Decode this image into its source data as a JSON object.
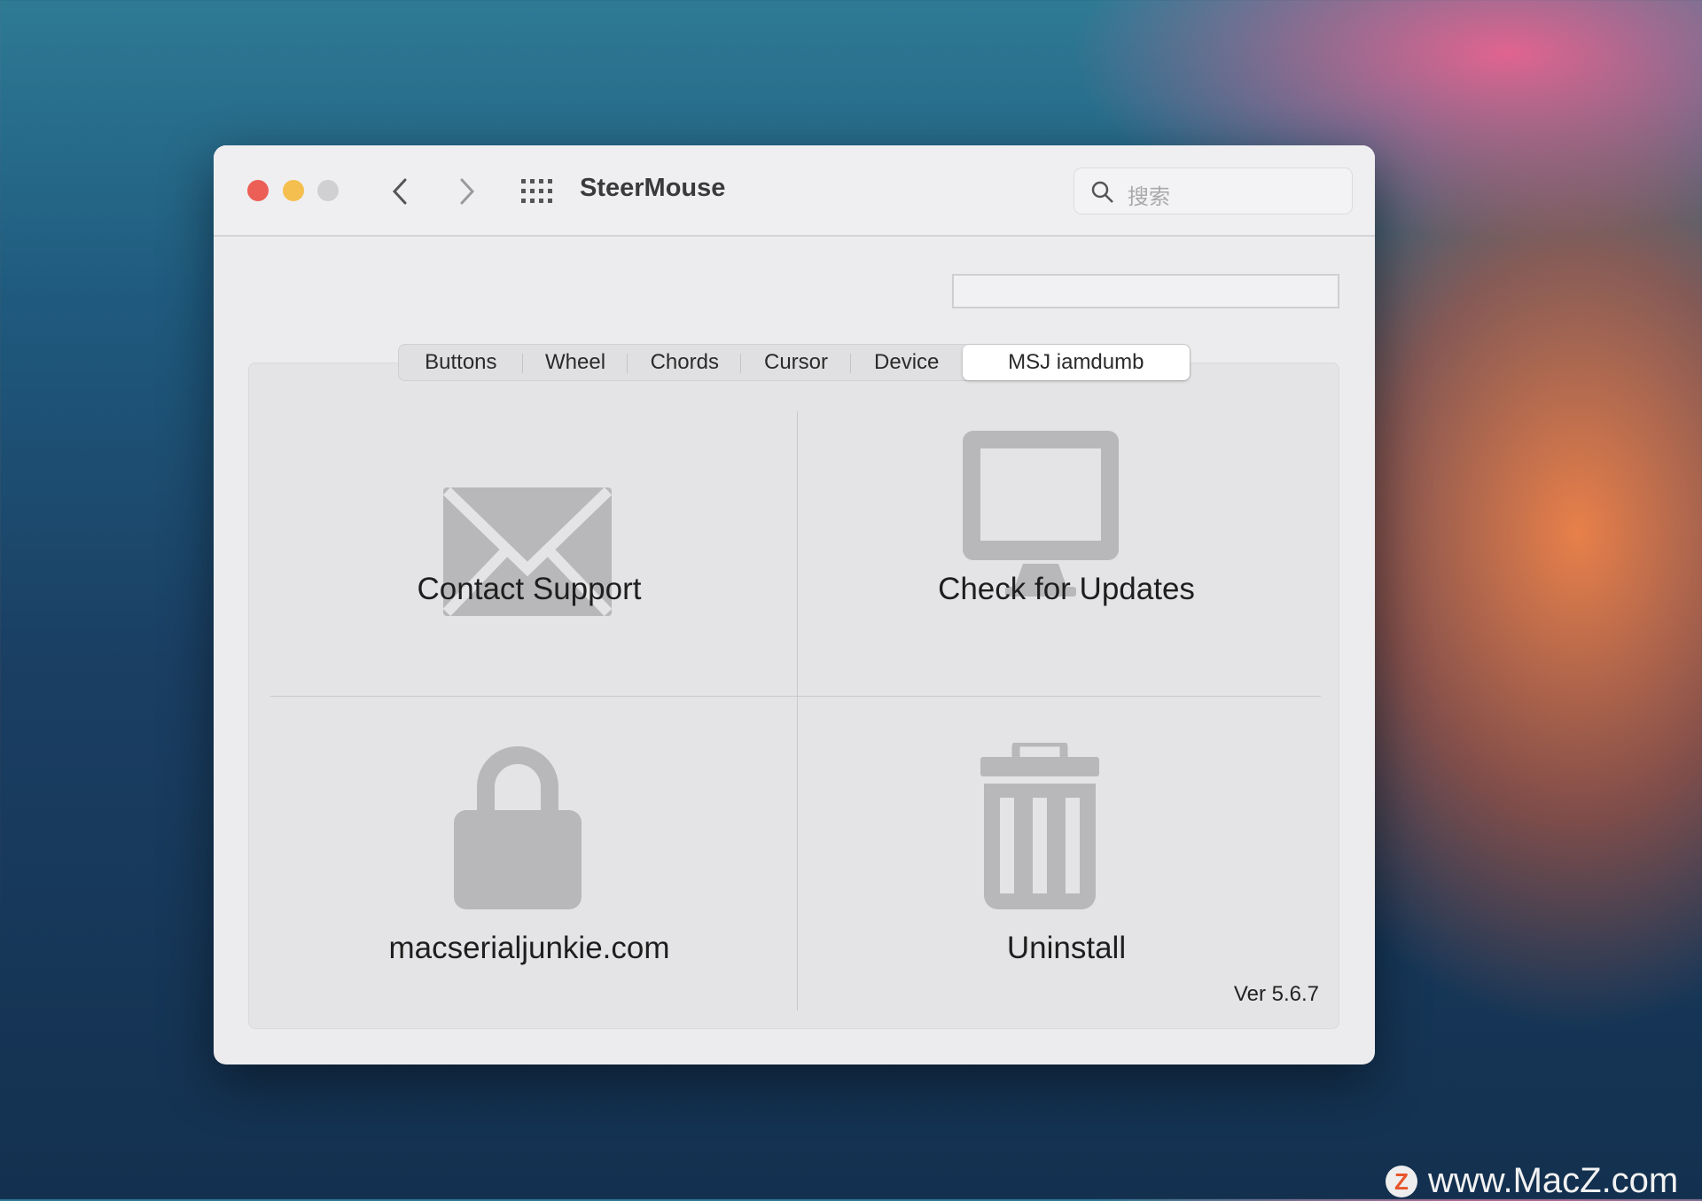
{
  "window": {
    "title": "SteerMouse",
    "search_placeholder": "搜索",
    "field_value": ""
  },
  "tabs": [
    {
      "label": "Buttons"
    },
    {
      "label": "Wheel"
    },
    {
      "label": "Chords"
    },
    {
      "label": "Cursor"
    },
    {
      "label": "Device"
    },
    {
      "label": "MSJ iamdumb",
      "selected": true
    }
  ],
  "cells": [
    {
      "label": "Contact Support",
      "icon": "envelope-icon"
    },
    {
      "label": "Check for Updates",
      "icon": "monitor-icon"
    },
    {
      "label": "macserialjunkie.com",
      "icon": "lock-icon"
    },
    {
      "label": "Uninstall",
      "icon": "trash-icon"
    }
  ],
  "version": "Ver 5.6.7",
  "watermark": {
    "text": "www.MacZ.com",
    "logo": "Z"
  },
  "colors": {
    "close": "#ec5f57",
    "minimize": "#f4bf4f",
    "zoom": "#d0d0d2",
    "icon_gray": "#b8b8ba"
  }
}
